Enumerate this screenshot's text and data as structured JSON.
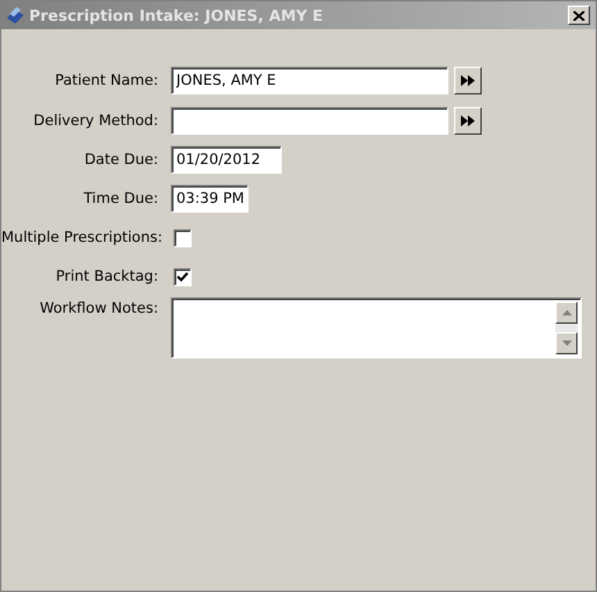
{
  "window": {
    "title": "Prescription Intake: JONES, AMY E"
  },
  "fields": [
    {
      "kind": "lookup",
      "label": "Patient Name:",
      "value": "JONES, AMY E"
    },
    {
      "kind": "lookup",
      "label": "Delivery Method:"
    },
    {
      "kind": "short",
      "label": "Date Due:",
      "value": "01/20/2012"
    },
    {
      "kind": "tiny",
      "label": "Time Due:",
      "value": "03:39 PM"
    },
    {
      "kind": "checkbox",
      "label": "Multiple Prescriptions:",
      "checked": false
    },
    {
      "kind": "checkbox",
      "label": "Print Backtag:",
      "checked": true
    },
    {
      "kind": "notes",
      "label": "Workflow Notes:"
    }
  ]
}
